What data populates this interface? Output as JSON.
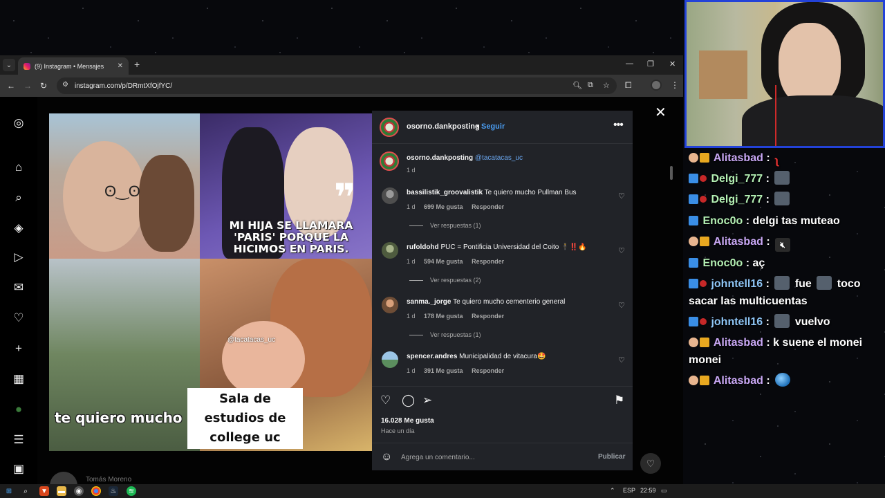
{
  "browser": {
    "tab_title": "(9) Instagram • Mensajes",
    "tab_close": "✕",
    "new_tab": "+",
    "url": "instagram.com/p/DRmtXfOjfYC/",
    "window_controls": [
      "—",
      "❐",
      "✕"
    ]
  },
  "post": {
    "image_captions": {
      "top_right": "MI HIJA SE LLAMARA 'PARIS' PORQUE LA HICIMOS EN PARIS.",
      "watermark": "@tacatacas_uc",
      "bottom_left": "te quiero mucho",
      "bottom_right": "Sala de estudios de college uc"
    },
    "header": {
      "username": "osorno.dankposting",
      "separator": "•",
      "follow_label": "Seguir",
      "more_icon": "more-dots-icon"
    },
    "caption": {
      "username": "osorno.dankposting",
      "text": "@tacatacas_uc",
      "time": "1 d"
    },
    "comments": [
      {
        "username": "bassilistik_groovalistik",
        "text": "Te quiero mucho Pullman Bus",
        "time": "1 d",
        "likes": "699 Me gusta",
        "reply": "Responder",
        "replies": "Ver respuestas (1)"
      },
      {
        "username": "rufoldohd",
        "text": "PUC = Pontificia Universidad del Coito 🕴️‼️🔥",
        "time": "1 d",
        "likes": "594 Me gusta",
        "reply": "Responder",
        "replies": "Ver respuestas (2)"
      },
      {
        "username": "sanma._jorge",
        "text": "Te quiero mucho cementerio general",
        "time": "1 d",
        "likes": "178 Me gusta",
        "reply": "Responder",
        "replies": "Ver respuestas (1)"
      },
      {
        "username": "spencer.andres",
        "text": "Municipalidad de vitacura🤩",
        "time": "1 d",
        "likes": "391 Me gusta",
        "reply": "Responder",
        "replies": ""
      }
    ],
    "likes_total": "16.028 Me gusta",
    "posted": "Hace un día",
    "comment_placeholder": "Agrega un comentario...",
    "publish_label": "Publicar"
  },
  "background": {
    "name": "Tomás Moreno"
  },
  "chat": {
    "messages": [
      {
        "user": "Alitasbad",
        "text": "",
        "badges": [
          "hand",
          "crown"
        ],
        "emote": "red-squiggle"
      },
      {
        "user": "Delgi_777",
        "text": "",
        "badges": [
          "prime",
          "sub"
        ],
        "emote": "face"
      },
      {
        "user": "Delgi_777",
        "text": "",
        "badges": [
          "prime",
          "sub"
        ],
        "emote": "face"
      },
      {
        "user": "Enoc0o",
        "text": "delgi tas muteao",
        "badges": [
          "prime"
        ],
        "emote": ""
      },
      {
        "user": "Alitasbad",
        "text": "",
        "badges": [
          "hand",
          "crown"
        ],
        "emote": "mute"
      },
      {
        "user": "Enoc0o",
        "text": "aç",
        "badges": [
          "prime"
        ],
        "emote": ""
      },
      {
        "user": "johntell16",
        "text_a": "fue",
        "text_b": "toco sacar las multicuentas",
        "badges": [
          "prime",
          "sub"
        ]
      },
      {
        "user": "johntell16",
        "text": "vuelvo",
        "badges": [
          "prime",
          "sub"
        ],
        "emote": "face"
      },
      {
        "user": "Alitasbad",
        "text": "k suene el monei monei",
        "badges": [
          "hand",
          "crown"
        ],
        "emote": ""
      },
      {
        "user": "Alitasbad",
        "text": "",
        "badges": [
          "hand",
          "crown"
        ],
        "emote": "globe"
      }
    ],
    "separator": ":"
  },
  "taskbar": {
    "language": "ESP",
    "clock": "22:59"
  }
}
